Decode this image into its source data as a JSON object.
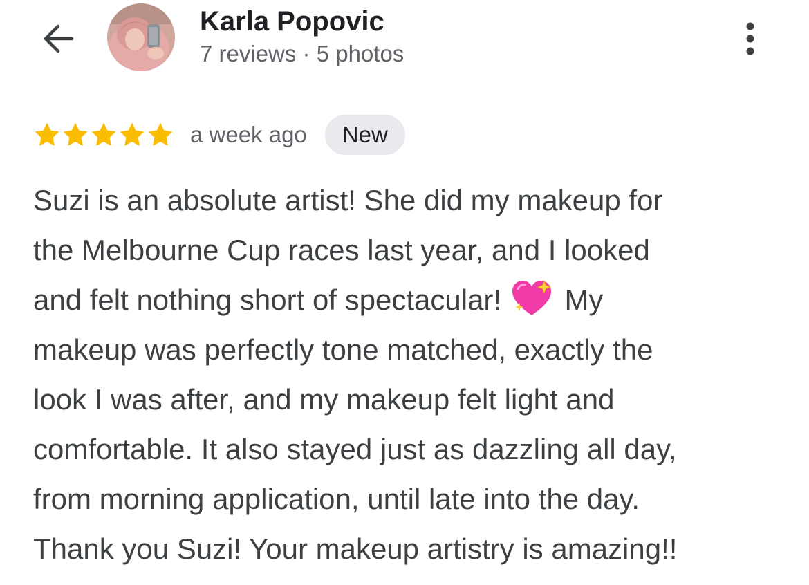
{
  "header": {
    "user_name": "Karla Popovic",
    "user_meta": "7 reviews · 5 photos",
    "back_icon": "arrow-back-icon",
    "more_icon": "more-vert-icon"
  },
  "review": {
    "rating": 5,
    "rating_max": 5,
    "date": "a week ago",
    "badge": "New",
    "text_part1": "Suzi is an absolute artist! She did my makeup for\nthe Melbourne Cup races last year, and I looked\nand felt nothing short of spectacular!",
    "emoji": "sparkling-heart-emoji",
    "text_part2": "My\nmakeup was perfectly tone matched, exactly the\nlook I was after, and my makeup felt light and\ncomfortable. It also stayed just as dazzling all day,\nfrom morning application, until late into the day.\nThank you Suzi! Your makeup artistry is amazing!!"
  },
  "colors": {
    "star": "#fbbc04",
    "name": "#202124",
    "secondary": "#5f6368",
    "body_text": "#3c4043",
    "badge_bg": "#e8eaed"
  }
}
